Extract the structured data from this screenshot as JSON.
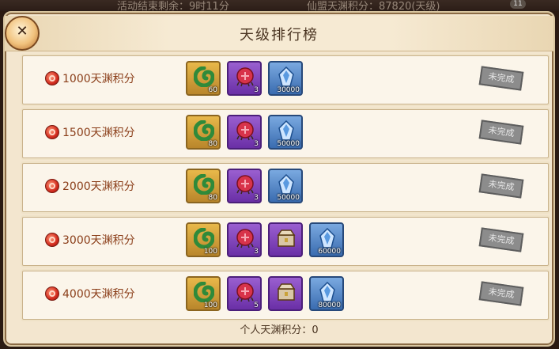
{
  "background": {
    "left_text": "活动结束剩余：9时11分",
    "right_text": "仙盟天渊积分：87820(天级)",
    "badge_count": "11"
  },
  "header": {
    "title": "天级排行榜"
  },
  "rows": [
    {
      "label": "1000天渊积分",
      "status": "未完成",
      "items": [
        {
          "name": "green-jade-icon",
          "style": "gold",
          "qty": "60"
        },
        {
          "name": "red-orb-icon",
          "style": "purple",
          "qty": "3"
        },
        {
          "name": "blue-crystal-icon",
          "style": "blue",
          "qty": "30000"
        }
      ]
    },
    {
      "label": "1500天渊积分",
      "status": "未完成",
      "items": [
        {
          "name": "green-jade-icon",
          "style": "gold",
          "qty": "80"
        },
        {
          "name": "red-orb-icon",
          "style": "purple",
          "qty": "3"
        },
        {
          "name": "blue-crystal-icon",
          "style": "blue",
          "qty": "50000"
        }
      ]
    },
    {
      "label": "2000天渊积分",
      "status": "未完成",
      "items": [
        {
          "name": "green-jade-icon",
          "style": "gold",
          "qty": "80"
        },
        {
          "name": "red-orb-icon",
          "style": "purple",
          "qty": "3"
        },
        {
          "name": "blue-crystal-icon",
          "style": "blue",
          "qty": "50000"
        }
      ]
    },
    {
      "label": "3000天渊积分",
      "status": "未完成",
      "items": [
        {
          "name": "green-jade-icon",
          "style": "gold",
          "qty": "100"
        },
        {
          "name": "red-orb-icon",
          "style": "purple",
          "qty": "3"
        },
        {
          "name": "treasure-chest-icon",
          "style": "purple",
          "qty": ""
        },
        {
          "name": "blue-crystal-icon",
          "style": "blue",
          "qty": "60000"
        }
      ]
    },
    {
      "label": "4000天渊积分",
      "status": "未完成",
      "items": [
        {
          "name": "green-jade-icon",
          "style": "gold",
          "qty": "100"
        },
        {
          "name": "red-orb-icon",
          "style": "purple",
          "qty": "5"
        },
        {
          "name": "treasure-chest-icon",
          "style": "purple",
          "qty": ""
        },
        {
          "name": "blue-crystal-icon",
          "style": "blue",
          "qty": "80000"
        }
      ]
    }
  ],
  "footer": {
    "text": "个人天渊积分：0"
  },
  "colors": {
    "panel": "#f3e6cf",
    "label_text": "#8a3d18",
    "status_stamp": "#8c8c8c"
  }
}
